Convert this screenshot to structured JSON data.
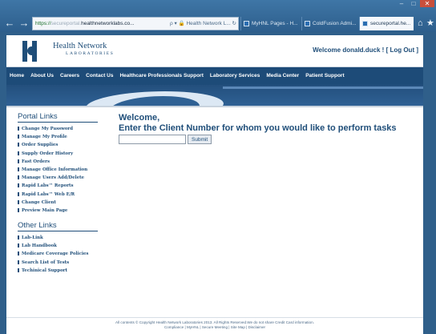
{
  "browser": {
    "window_controls": {
      "minimize": "–",
      "maximize": "□",
      "close": "✕"
    },
    "back_glyph": "←",
    "forward_glyph": "→",
    "address": {
      "protocol": "https://",
      "faded": "secureportal.",
      "domain": "healthnetworklabs.co...",
      "icons": "ρ ▾ 🔒 Health Network L... ↻"
    },
    "tabs": [
      {
        "label": "MyHNL Pages - H..."
      },
      {
        "label": "ColdFusion Admi..."
      },
      {
        "label": "secureportal.he...",
        "close": "✕"
      }
    ],
    "home_glyph": "⌂",
    "star_glyph": "★"
  },
  "header": {
    "logo_name": "Health Network",
    "logo_sub": "LABORATORIES",
    "welcome_user": "Welcome donald.duck ! [ Log Out ]"
  },
  "nav": {
    "items": [
      "Home",
      "About Us",
      "Careers",
      "Contact Us",
      "Healthcare Professionals Support",
      "Laboratory Services",
      "Media Center",
      "Patient Support"
    ]
  },
  "sidebar": {
    "portal_title": "Portal Links",
    "portal_links": [
      "Change My Password",
      "Manage My Profile",
      "Order Supplies",
      "Supply Order History",
      "Fast Orders",
      "Manage Office Information",
      "Manage Users Add/Delete",
      "Rapid Labs™ Reports",
      "Rapid Labs™ Web E/R",
      "Change Client",
      "Preview Main Page"
    ],
    "other_title": "Other Links",
    "other_links": [
      "Lab-Link",
      "Lab Handbook",
      "Medicare Coverage Policies",
      "Search List of Tests",
      "Techinical Support"
    ]
  },
  "main": {
    "greeting": "Welcome,",
    "prompt": "Enter the Client Number for whom you would like to perform tasks",
    "client_input_value": "",
    "submit_label": "Submit"
  },
  "footer": {
    "line1": "All contents © Copyright Health Network Laboratories 2013. All Rights Reserved.We do not share Credit Card information.",
    "line2": "Compliance | MyHNL | Secure Meeting | Site Map | Disclaimer"
  }
}
